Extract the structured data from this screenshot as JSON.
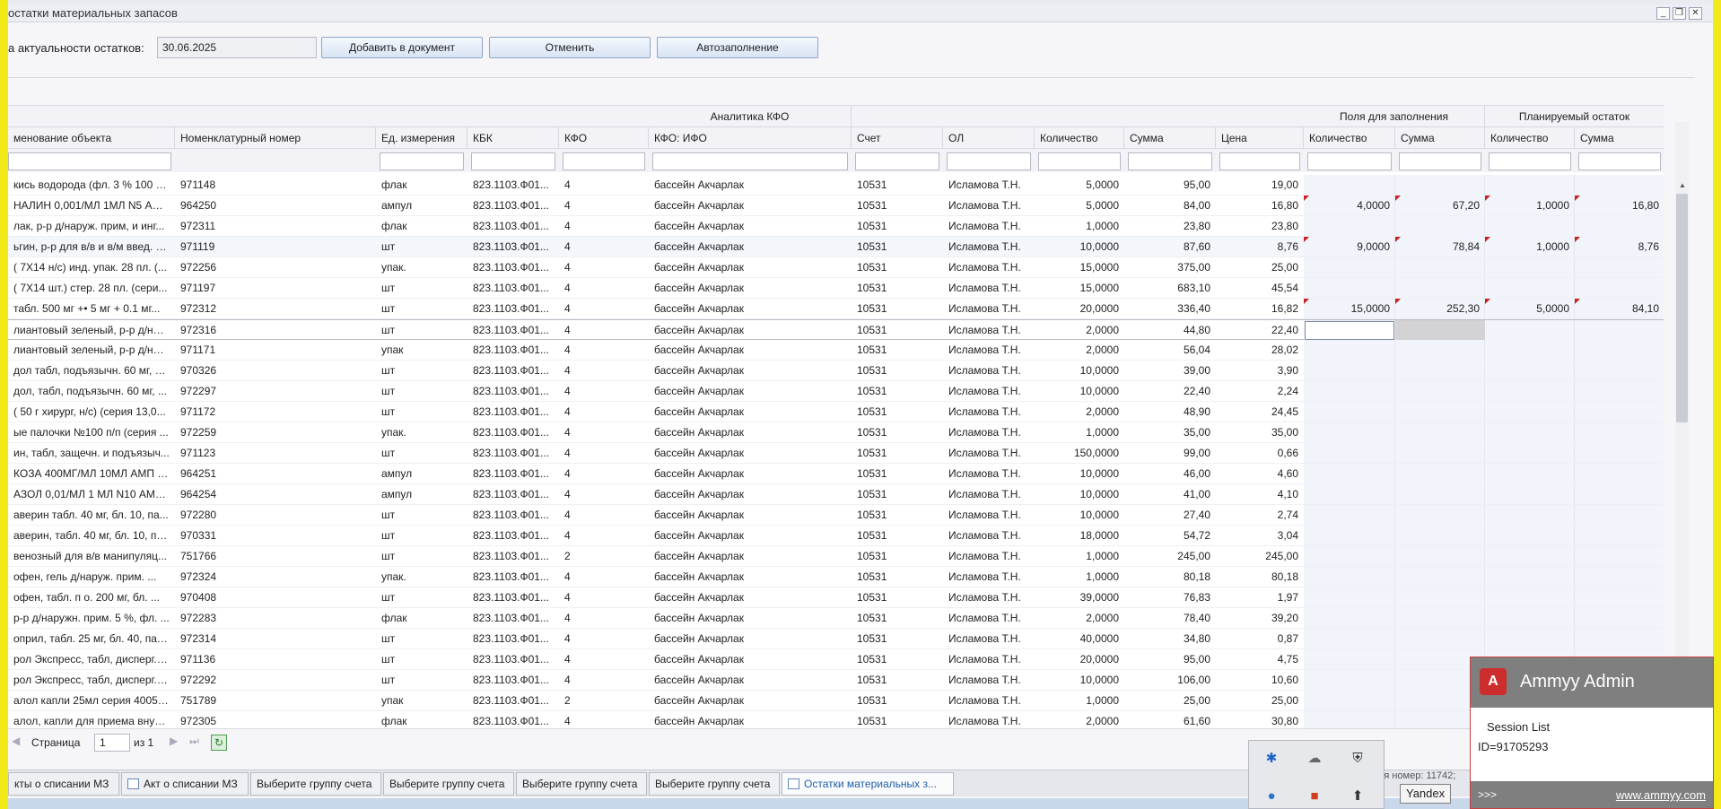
{
  "window": {
    "title": "остатки материальных запасов"
  },
  "form": {
    "date_label": "а актуальности остатков:",
    "date_value": "30.06.2025",
    "add_button": "Добавить в документ",
    "cancel_button": "Отменить",
    "autofill_button": "Автозаполнение"
  },
  "grid": {
    "groups": {
      "kfo": "Аналитика КФО",
      "fill": "Поля для заполнения",
      "plan": "Планируемый остаток"
    },
    "columns": {
      "name": "менование объекта",
      "nomen": "Номенклатурный номер",
      "unit": "Ед. измерения",
      "kbk": "КБК",
      "kfo": "КФО",
      "kfo_ifo": "КФО: ИФО",
      "account": "Счет",
      "ol": "ОЛ",
      "qty": "Количество",
      "sum": "Сумма",
      "price": "Цена",
      "fill_qty": "Количество",
      "fill_sum": "Сумма",
      "plan_qty": "Количество",
      "plan_sum": "Сумма"
    },
    "rows": [
      {
        "name": "кись водорода (фл. 3 % 100 м...",
        "nomen": "971148",
        "unit": "флак",
        "kbk": "823.1103.Ф01...",
        "kfo": "4",
        "ifo": "бассейн Акчарлак",
        "acc": "10531",
        "ol": "Исламова Т.Н.",
        "qty": "5,0000",
        "sum": "95,00",
        "price": "19,00",
        "fq": "",
        "fs": "",
        "pq": "",
        "ps": ""
      },
      {
        "name": "НАЛИН 0,001/МЛ 1МЛ N5 АМ...",
        "nomen": "964250",
        "unit": "ампул",
        "kbk": "823.1103.Ф01...",
        "kfo": "4",
        "ifo": "бассейн Акчарлак",
        "acc": "10531",
        "ol": "Исламова Т.Н.",
        "qty": "5,0000",
        "sum": "84,00",
        "price": "16,80",
        "fq": "4,0000",
        "fs": "67,20",
        "pq": "1,0000",
        "ps": "16,80"
      },
      {
        "name": "лак, р-р д/наруж. прим, и инг...",
        "nomen": "972311",
        "unit": "флак",
        "kbk": "823.1103.Ф01...",
        "kfo": "4",
        "ifo": "бассейн Акчарлак",
        "acc": "10531",
        "ol": "Исламова Т.Н.",
        "qty": "1,0000",
        "sum": "23,80",
        "price": "23,80",
        "fq": "",
        "fs": "",
        "pq": "",
        "ps": ""
      },
      {
        "name": "ьгин, р-р для в/в и в/м введ. 5...",
        "nomen": "971119",
        "unit": "шт",
        "kbk": "823.1103.Ф01...",
        "kfo": "4",
        "ifo": "бассейн Акчарлак",
        "acc": "10531",
        "ol": "Исламова Т.Н.",
        "qty": "10,0000",
        "sum": "87,60",
        "price": "8,76",
        "fq": "9,0000",
        "fs": "78,84",
        "pq": "1,0000",
        "ps": "8,76"
      },
      {
        "name": "( 7X14 н/с) инд. упак. 28 пл. (...",
        "nomen": "972256",
        "unit": "упак.",
        "kbk": "823.1103.Ф01...",
        "kfo": "4",
        "ifo": "бассейн Акчарлак",
        "acc": "10531",
        "ol": "Исламова Т.Н.",
        "qty": "15,0000",
        "sum": "375,00",
        "price": "25,00",
        "fq": "",
        "fs": "",
        "pq": "",
        "ps": ""
      },
      {
        "name": "( 7X14 шт.) стер. 28 пл. (сери...",
        "nomen": "971197",
        "unit": "шт",
        "kbk": "823.1103.Ф01...",
        "kfo": "4",
        "ifo": "бассейн Акчарлак",
        "acc": "10531",
        "ol": "Исламова Т.Н.",
        "qty": "15,0000",
        "sum": "683,10",
        "price": "45,54",
        "fq": "",
        "fs": "",
        "pq": "",
        "ps": ""
      },
      {
        "name": "табл. 500 мг +• 5 мг + 0.1 мг...",
        "nomen": "972312",
        "unit": "шт",
        "kbk": "823.1103.Ф01...",
        "kfo": "4",
        "ifo": "бассейн Акчарлак",
        "acc": "10531",
        "ol": "Исламова Т.Н.",
        "qty": "20,0000",
        "sum": "336,40",
        "price": "16,82",
        "fq": "15,0000",
        "fs": "252,30",
        "pq": "5,0000",
        "ps": "84,10"
      },
      {
        "name": "лиантовый зеленый, р-р д/нар...",
        "nomen": "972316",
        "unit": "шт",
        "kbk": "823.1103.Ф01...",
        "kfo": "4",
        "ifo": "бассейн Акчарлак",
        "acc": "10531",
        "ol": "Исламова Т.Н.",
        "qty": "2,0000",
        "sum": "44,80",
        "price": "22,40",
        "fq": "",
        "fs": "",
        "pq": "",
        "ps": ""
      },
      {
        "name": "лиантовый зеленый, р-р д/нар...",
        "nomen": "971171",
        "unit": "упак",
        "kbk": "823.1103.Ф01...",
        "kfo": "4",
        "ifo": "бассейн Акчарлак",
        "acc": "10531",
        "ol": "Исламова Т.Н.",
        "qty": "2,0000",
        "sum": "56,04",
        "price": "28,02",
        "fq": "",
        "fs": "",
        "pq": "",
        "ps": ""
      },
      {
        "name": "дол табл, подъязычн. 60 мг, б...",
        "nomen": "970326",
        "unit": "шт",
        "kbk": "823.1103.Ф01...",
        "kfo": "4",
        "ifo": "бассейн Акчарлак",
        "acc": "10531",
        "ol": "Исламова Т.Н.",
        "qty": "10,0000",
        "sum": "39,00",
        "price": "3,90",
        "fq": "",
        "fs": "",
        "pq": "",
        "ps": ""
      },
      {
        "name": "дол, табл, подъязычн. 60 мг, ...",
        "nomen": "972297",
        "unit": "шт",
        "kbk": "823.1103.Ф01...",
        "kfo": "4",
        "ifo": "бассейн Акчарлак",
        "acc": "10531",
        "ol": "Исламова Т.Н.",
        "qty": "10,0000",
        "sum": "22,40",
        "price": "2,24",
        "fq": "",
        "fs": "",
        "pq": "",
        "ps": ""
      },
      {
        "name": "( 50 г хирург, н/с) (серия 13,0...",
        "nomen": "971172",
        "unit": "шт",
        "kbk": "823.1103.Ф01...",
        "kfo": "4",
        "ifo": "бассейн Акчарлак",
        "acc": "10531",
        "ol": "Исламова Т.Н.",
        "qty": "2,0000",
        "sum": "48,90",
        "price": "24,45",
        "fq": "",
        "fs": "",
        "pq": "",
        "ps": ""
      },
      {
        "name": "ые палочки №100 п/п (серия ...",
        "nomen": "972259",
        "unit": "упак.",
        "kbk": "823.1103.Ф01...",
        "kfo": "4",
        "ifo": "бассейн Акчарлак",
        "acc": "10531",
        "ol": "Исламова Т.Н.",
        "qty": "1,0000",
        "sum": "35,00",
        "price": "35,00",
        "fq": "",
        "fs": "",
        "pq": "",
        "ps": ""
      },
      {
        "name": "ин, табл, защечн. и подъязыч...",
        "nomen": "971123",
        "unit": "шт",
        "kbk": "823.1103.Ф01...",
        "kfo": "4",
        "ifo": "бассейн Акчарлак",
        "acc": "10531",
        "ol": "Исламова Т.Н.",
        "qty": "150,0000",
        "sum": "99,00",
        "price": "0,66",
        "fq": "",
        "fs": "",
        "pq": "",
        "ps": ""
      },
      {
        "name": "КОЗА 400МГ/МЛ 10МЛ АМП №...",
        "nomen": "964251",
        "unit": "ампул",
        "kbk": "823.1103.Ф01...",
        "kfo": "4",
        "ifo": "бассейн Акчарлак",
        "acc": "10531",
        "ol": "Исламова Т.Н.",
        "qty": "10,0000",
        "sum": "46,00",
        "price": "4,60",
        "fq": "",
        "fs": "",
        "pq": "",
        "ps": ""
      },
      {
        "name": "АЗОЛ 0,01/МЛ 1 МЛ N10 АМП Р...",
        "nomen": "964254",
        "unit": "ампул",
        "kbk": "823.1103.Ф01...",
        "kfo": "4",
        "ifo": "бассейн Акчарлак",
        "acc": "10531",
        "ol": "Исламова Т.Н.",
        "qty": "10,0000",
        "sum": "41,00",
        "price": "4,10",
        "fq": "",
        "fs": "",
        "pq": "",
        "ps": ""
      },
      {
        "name": "аверин табл. 40 мг, бл. 10, па...",
        "nomen": "972280",
        "unit": "шт",
        "kbk": "823.1103.Ф01...",
        "kfo": "4",
        "ifo": "бассейн Акчарлак",
        "acc": "10531",
        "ol": "Исламова Т.Н.",
        "qty": "10,0000",
        "sum": "27,40",
        "price": "2,74",
        "fq": "",
        "fs": "",
        "pq": "",
        "ps": ""
      },
      {
        "name": "аверин, табл. 40 мг, бл. 10, па...",
        "nomen": "970331",
        "unit": "шт",
        "kbk": "823.1103.Ф01...",
        "kfo": "4",
        "ifo": "бассейн Акчарлак",
        "acc": "10531",
        "ol": "Исламова Т.Н.",
        "qty": "18,0000",
        "sum": "54,72",
        "price": "3,04",
        "fq": "",
        "fs": "",
        "pq": "",
        "ps": ""
      },
      {
        "name": "венозный для в/в манипуляц...",
        "nomen": "751766",
        "unit": "шт",
        "kbk": "823.1103.Ф01...",
        "kfo": "2",
        "ifo": "бассейн Акчарлак",
        "acc": "10531",
        "ol": "Исламова Т.Н.",
        "qty": "1,0000",
        "sum": "245,00",
        "price": "245,00",
        "fq": "",
        "fs": "",
        "pq": "",
        "ps": ""
      },
      {
        "name": "офен, гель д/наруж. прим. ...",
        "nomen": "972324",
        "unit": "упак.",
        "kbk": "823.1103.Ф01...",
        "kfo": "4",
        "ifo": "бассейн Акчарлак",
        "acc": "10531",
        "ol": "Исламова Т.Н.",
        "qty": "1,0000",
        "sum": "80,18",
        "price": "80,18",
        "fq": "",
        "fs": "",
        "pq": "",
        "ps": ""
      },
      {
        "name": "офен, табл. п о. 200 мг, бл. ...",
        "nomen": "970408",
        "unit": "шт",
        "kbk": "823.1103.Ф01...",
        "kfo": "4",
        "ifo": "бассейн Акчарлак",
        "acc": "10531",
        "ol": "Исламова Т.Н.",
        "qty": "39,0000",
        "sum": "76,83",
        "price": "1,97",
        "fq": "",
        "fs": "",
        "pq": "",
        "ps": ""
      },
      {
        "name": "р-р д/наружн. прим. 5 %, фл. ...",
        "nomen": "972283",
        "unit": "флак",
        "kbk": "823.1103.Ф01...",
        "kfo": "4",
        "ifo": "бассейн Акчарлак",
        "acc": "10531",
        "ol": "Исламова Т.Н.",
        "qty": "2,0000",
        "sum": "78,40",
        "price": "39,20",
        "fq": "",
        "fs": "",
        "pq": "",
        "ps": ""
      },
      {
        "name": "оприл, табл. 25 мг, бл. 40, пач...",
        "nomen": "972314",
        "unit": "шт",
        "kbk": "823.1103.Ф01...",
        "kfo": "4",
        "ifo": "бассейн Акчарлак",
        "acc": "10531",
        "ol": "Исламова Т.Н.",
        "qty": "40,0000",
        "sum": "34,80",
        "price": "0,87",
        "fq": "",
        "fs": "",
        "pq": "",
        "ps": ""
      },
      {
        "name": "рол Экспресс, табл, дисперг. в...",
        "nomen": "971136",
        "unit": "шт",
        "kbk": "823.1103.Ф01...",
        "kfo": "4",
        "ifo": "бассейн Акчарлак",
        "acc": "10531",
        "ol": "Исламова Т.Н.",
        "qty": "20,0000",
        "sum": "95,00",
        "price": "4,75",
        "fq": "",
        "fs": "",
        "pq": "",
        "ps": ""
      },
      {
        "name": "рол Экспресс, табл, дисперг. в...",
        "nomen": "972292",
        "unit": "шт",
        "kbk": "823.1103.Ф01...",
        "kfo": "4",
        "ifo": "бассейн Акчарлак",
        "acc": "10531",
        "ol": "Исламова Т.Н.",
        "qty": "10,0000",
        "sum": "106,00",
        "price": "10,60",
        "fq": "",
        "fs": "",
        "pq": "",
        "ps": ""
      },
      {
        "name": "алол капли 25мл серия 40052...",
        "nomen": "751789",
        "unit": "упак",
        "kbk": "823.1103.Ф01...",
        "kfo": "2",
        "ifo": "бассейн Акчарлак",
        "acc": "10531",
        "ol": "Исламова Т.Н.",
        "qty": "1,0000",
        "sum": "25,00",
        "price": "25,00",
        "fq": "",
        "fs": "",
        "pq": "",
        "ps": ""
      },
      {
        "name": "алол, капли для приема внутр...",
        "nomen": "972305",
        "unit": "флак",
        "kbk": "823.1103.Ф01...",
        "kfo": "4",
        "ifo": "бассейн Акчарлак",
        "acc": "10531",
        "ol": "Исламова Т.Н.",
        "qty": "2,0000",
        "sum": "61,60",
        "price": "30,80",
        "fq": "",
        "fs": "",
        "pq": "",
        "ps": ""
      }
    ]
  },
  "pager": {
    "page_label": "Страница",
    "page_value": "1",
    "of_label": "из 1"
  },
  "tabs": [
    "кты о списании МЗ",
    "Акт о списании МЗ",
    "Выберите группу счета",
    "Выберите группу счета",
    "Выберите группу счета",
    "Выберите группу счета",
    "Остатки материальных з..."
  ],
  "status": {
    "text": "ания номер: 11742;"
  },
  "tooltip": {
    "text": "Yandex"
  },
  "ammyy": {
    "title": "Ammyy Admin",
    "session_list": "Session List",
    "id": "ID=91705293",
    "more": ">>>",
    "url": "www.ammyy.com"
  },
  "colors": {
    "border_accent": "#f2ea18",
    "marker": "#c82222",
    "ammyy_brand": "#cc2d2d"
  }
}
